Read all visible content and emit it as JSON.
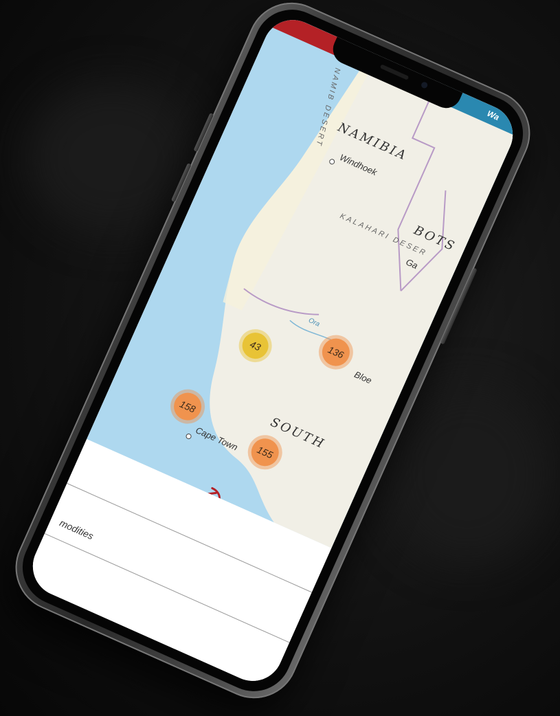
{
  "header": {
    "tab_label": "Wa"
  },
  "map": {
    "countries": [
      "NAMIBIA",
      "BOTS",
      "SOUTH"
    ],
    "deserts": [
      "NAMIB DESERT",
      "KALAHARI DESER"
    ],
    "cities": [
      "Windhoek",
      "Cape Town",
      "Ga",
      "Bloe"
    ],
    "river": "Ora",
    "clusters": [
      {
        "count": "43",
        "color": "yellow"
      },
      {
        "count": "136",
        "color": "orange"
      },
      {
        "count": "158",
        "color": "orange"
      },
      {
        "count": "155",
        "color": "orange"
      }
    ],
    "colors": {
      "water": "#aed8ef",
      "land": "#f1efe6",
      "border": "#b89ac6",
      "cluster_orange": "#f0934e",
      "cluster_yellow": "#e8c336",
      "accent_red": "#b42126",
      "accent_blue": "#2a88b0"
    }
  },
  "sheet": {
    "row_label": "modities"
  },
  "icons": [
    "pickaxe-icon"
  ]
}
